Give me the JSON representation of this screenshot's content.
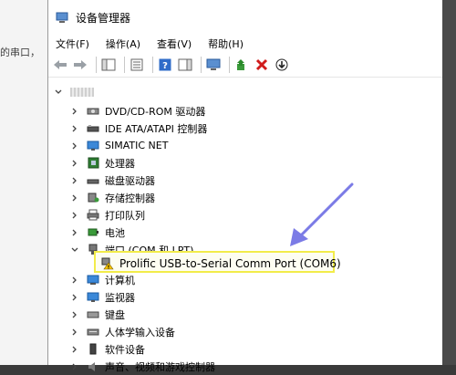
{
  "background": {
    "left_text": "的串口，"
  },
  "window": {
    "title": "设备管理器"
  },
  "menu": [
    {
      "label": "文件(F)"
    },
    {
      "label": "操作(A)"
    },
    {
      "label": "查看(V)"
    },
    {
      "label": "帮助(H)"
    }
  ],
  "tree": {
    "items": [
      {
        "label": "DVD/CD-ROM 驱动器",
        "icon": "dvd-drive-icon"
      },
      {
        "label": "IDE ATA/ATAPI 控制器",
        "icon": "ide-controller-icon"
      },
      {
        "label": "SIMATIC NET",
        "icon": "network-icon"
      },
      {
        "label": "处理器",
        "icon": "processor-icon"
      },
      {
        "label": "磁盘驱动器",
        "icon": "disk-drive-icon"
      },
      {
        "label": "存储控制器",
        "icon": "storage-controller-icon"
      },
      {
        "label": "打印队列",
        "icon": "printer-icon"
      },
      {
        "label": "电池",
        "icon": "battery-icon"
      },
      {
        "label": "端口 (COM 和 LPT)",
        "icon": "port-icon",
        "expanded": true
      },
      {
        "label": "Prolific USB-to-Serial Comm Port (COM6)",
        "icon": "warning-port-icon",
        "child": true
      },
      {
        "label": "计算机",
        "icon": "computer-icon"
      },
      {
        "label": "监视器",
        "icon": "monitor-icon"
      },
      {
        "label": "键盘",
        "icon": "keyboard-icon"
      },
      {
        "label": "人体学输入设备",
        "icon": "hid-icon"
      },
      {
        "label": "软件设备",
        "icon": "software-device-icon"
      },
      {
        "label": "声音、视频和游戏控制器",
        "icon": "sound-icon"
      }
    ]
  },
  "colors": {
    "highlight_border": "#f2ec4a",
    "arrow": "#7b7be6",
    "warning": "#f5c400"
  }
}
